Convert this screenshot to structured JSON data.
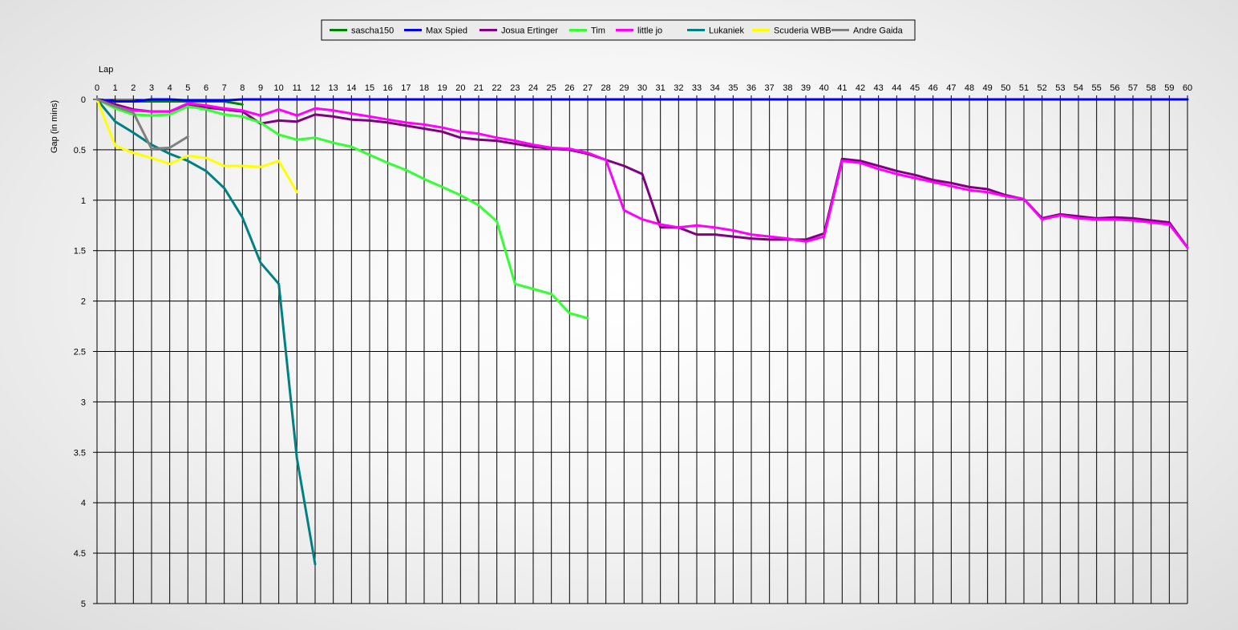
{
  "chart_data": {
    "type": "line",
    "title": "",
    "xlabel": "Lap",
    "ylabel": "Gap (in mins)",
    "x_axis_position": "top",
    "y_inverted": true,
    "xlim": [
      0,
      60
    ],
    "ylim": [
      0,
      5
    ],
    "xticks": [
      0,
      1,
      2,
      3,
      4,
      5,
      6,
      7,
      8,
      9,
      10,
      11,
      12,
      13,
      14,
      15,
      16,
      17,
      18,
      19,
      20,
      21,
      22,
      23,
      24,
      25,
      26,
      27,
      28,
      29,
      30,
      31,
      32,
      33,
      34,
      35,
      36,
      37,
      38,
      39,
      40,
      41,
      42,
      43,
      44,
      45,
      46,
      47,
      48,
      49,
      50,
      51,
      52,
      53,
      54,
      55,
      56,
      57,
      58,
      59,
      60
    ],
    "yticks": [
      0,
      0.5,
      1,
      1.5,
      2,
      2.5,
      3,
      3.5,
      4,
      4.5,
      5
    ],
    "ytick_labels": [
      "0",
      "0.5",
      "1",
      "1.5",
      "2",
      "2.5",
      "3",
      "3.5",
      "4",
      "4.5",
      "5"
    ],
    "grid": true,
    "legend_position": "top-center",
    "series": [
      {
        "name": "sascha150",
        "color": "#008000",
        "x": [
          0,
          1,
          2,
          3,
          4,
          5,
          6,
          7,
          8
        ],
        "y": [
          0,
          0.02,
          0.02,
          0.02,
          0.02,
          0.02,
          0.02,
          0.02,
          0.05
        ]
      },
      {
        "name": "Max Spied",
        "color": "#0000ff",
        "x": [
          0,
          1,
          2,
          3,
          4,
          5,
          6,
          7,
          8,
          9,
          10,
          11,
          12,
          13,
          14,
          15,
          16,
          17,
          18,
          19,
          20,
          21,
          22,
          23,
          24,
          25,
          26,
          27,
          28,
          29,
          30,
          31,
          32,
          33,
          34,
          35,
          36,
          37,
          38,
          39,
          40,
          41,
          42,
          43,
          44,
          45,
          46,
          47,
          48,
          49,
          50,
          51,
          52,
          53,
          54,
          55,
          56,
          57,
          58,
          59,
          60
        ],
        "y": [
          0,
          0.02,
          0.02,
          0,
          0,
          0.01,
          0.01,
          0.01,
          0,
          0,
          0,
          0,
          0,
          0,
          0,
          0,
          0,
          0,
          0,
          0,
          0,
          0,
          0,
          0,
          0,
          0,
          0,
          0,
          0,
          0,
          0,
          0,
          0,
          0,
          0,
          0,
          0,
          0,
          0,
          0,
          0,
          0,
          0,
          0,
          0,
          0,
          0,
          0,
          0,
          0,
          0,
          0,
          0,
          0,
          0,
          0,
          0,
          0,
          0,
          0,
          0
        ]
      },
      {
        "name": "Josua Ertinger",
        "color": "#800080",
        "x": [
          0,
          1,
          2,
          3,
          4,
          5,
          6,
          7,
          8,
          9,
          10,
          11,
          12,
          13,
          14,
          15,
          16,
          17,
          18,
          19,
          20,
          21,
          22,
          23,
          24,
          25,
          26,
          27,
          28,
          29,
          30,
          31,
          32,
          33,
          34,
          35,
          36,
          37,
          38,
          39,
          40,
          41,
          42,
          43,
          44,
          45,
          46,
          47,
          48,
          49,
          50,
          51,
          52,
          53,
          54,
          55,
          56,
          57,
          58,
          59,
          60
        ],
        "y": [
          0,
          0.05,
          0.1,
          0.12,
          0.12,
          0.05,
          0.08,
          0.1,
          0.12,
          0.24,
          0.21,
          0.22,
          0.15,
          0.17,
          0.2,
          0.21,
          0.23,
          0.26,
          0.29,
          0.32,
          0.38,
          0.4,
          0.41,
          0.44,
          0.47,
          0.49,
          0.5,
          0.54,
          0.6,
          0.66,
          0.74,
          1.27,
          1.27,
          1.34,
          1.34,
          1.36,
          1.38,
          1.39,
          1.39,
          1.39,
          1.33,
          0.59,
          0.61,
          0.66,
          0.71,
          0.75,
          0.8,
          0.83,
          0.87,
          0.89,
          0.95,
          0.99,
          1.18,
          1.14,
          1.16,
          1.18,
          1.17,
          1.18,
          1.2,
          1.22,
          1.47
        ]
      },
      {
        "name": "Tim",
        "color": "#33ff33",
        "x": [
          0,
          1,
          2,
          3,
          4,
          5,
          6,
          7,
          8,
          9,
          10,
          11,
          12,
          13,
          14,
          15,
          16,
          17,
          18,
          19,
          20,
          21,
          22,
          23,
          24,
          25,
          26,
          27
        ],
        "y": [
          0,
          0.09,
          0.15,
          0.16,
          0.15,
          0.07,
          0.1,
          0.15,
          0.17,
          0.23,
          0.35,
          0.4,
          0.38,
          0.43,
          0.47,
          0.55,
          0.63,
          0.7,
          0.79,
          0.87,
          0.95,
          1.05,
          1.21,
          1.83,
          1.88,
          1.93,
          2.12,
          2.17
        ]
      },
      {
        "name": "little jo",
        "color": "#ff00ff",
        "x": [
          0,
          1,
          2,
          3,
          4,
          5,
          6,
          7,
          8,
          9,
          10,
          11,
          12,
          13,
          14,
          15,
          16,
          17,
          18,
          19,
          20,
          21,
          22,
          23,
          24,
          25,
          26,
          27,
          28,
          29,
          30,
          31,
          32,
          33,
          34,
          35,
          36,
          37,
          38,
          39,
          40,
          41,
          42,
          43,
          44,
          45,
          46,
          47,
          48,
          49,
          50,
          51,
          52,
          53,
          54,
          55,
          56,
          57,
          58,
          59,
          60
        ],
        "y": [
          0,
          0.07,
          0.11,
          0.12,
          0.12,
          0.04,
          0.06,
          0.09,
          0.11,
          0.16,
          0.1,
          0.16,
          0.09,
          0.11,
          0.14,
          0.17,
          0.2,
          0.23,
          0.25,
          0.28,
          0.32,
          0.34,
          0.38,
          0.41,
          0.45,
          0.48,
          0.49,
          0.53,
          0.6,
          1.1,
          1.19,
          1.24,
          1.27,
          1.25,
          1.27,
          1.3,
          1.34,
          1.36,
          1.38,
          1.41,
          1.36,
          0.61,
          0.63,
          0.69,
          0.74,
          0.78,
          0.82,
          0.86,
          0.9,
          0.92,
          0.96,
          0.99,
          1.19,
          1.15,
          1.18,
          1.19,
          1.19,
          1.2,
          1.22,
          1.24,
          1.47
        ]
      },
      {
        "name": "Lukaniek",
        "color": "#008080",
        "x": [
          0,
          1,
          2,
          3,
          4,
          5,
          6,
          7,
          8,
          9,
          10,
          11,
          12
        ],
        "y": [
          0,
          0.22,
          0.33,
          0.45,
          0.54,
          0.61,
          0.71,
          0.88,
          1.17,
          1.62,
          1.83,
          3.56,
          4.61
        ]
      },
      {
        "name": "Scuderia WBB",
        "color": "#ffff00",
        "x": [
          0,
          1,
          2,
          3,
          4,
          5,
          6,
          7,
          8,
          9,
          10,
          11
        ],
        "y": [
          0,
          0.46,
          0.53,
          0.58,
          0.64,
          0.56,
          0.58,
          0.66,
          0.66,
          0.67,
          0.61,
          0.92
        ]
      },
      {
        "name": "Andre Gaida",
        "color": "#808080",
        "x": [
          0,
          1,
          2,
          3,
          4,
          5
        ],
        "y": [
          0,
          0.07,
          0.13,
          0.49,
          0.48,
          0.37
        ]
      }
    ]
  }
}
